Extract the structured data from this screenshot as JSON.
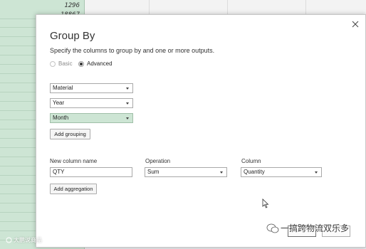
{
  "spreadsheet": {
    "visible_cells": [
      "1296",
      "18867"
    ]
  },
  "dialog": {
    "title": "Group By",
    "subtitle": "Specify the columns to group by and one or more outputs.",
    "mode_options": [
      {
        "label": "Basic",
        "selected": false
      },
      {
        "label": "Advanced",
        "selected": true
      }
    ],
    "groupings": [
      "Material",
      "Year",
      "Month"
    ],
    "add_grouping_label": "Add grouping",
    "headers": {
      "new_column_name": "New column name",
      "operation": "Operation",
      "column": "Column"
    },
    "aggregation": {
      "new_column_name": "QTY",
      "operation": "Sum",
      "column": "Quantity"
    },
    "add_aggregation_label": "Add aggregation",
    "close_icon": "close-icon"
  },
  "watermarks": {
    "left": "大鹏说商品",
    "right": "一搞跨物流双乐多"
  },
  "colors": {
    "highlight": "#cde5d4",
    "dialog_bg": "#ffffff"
  }
}
